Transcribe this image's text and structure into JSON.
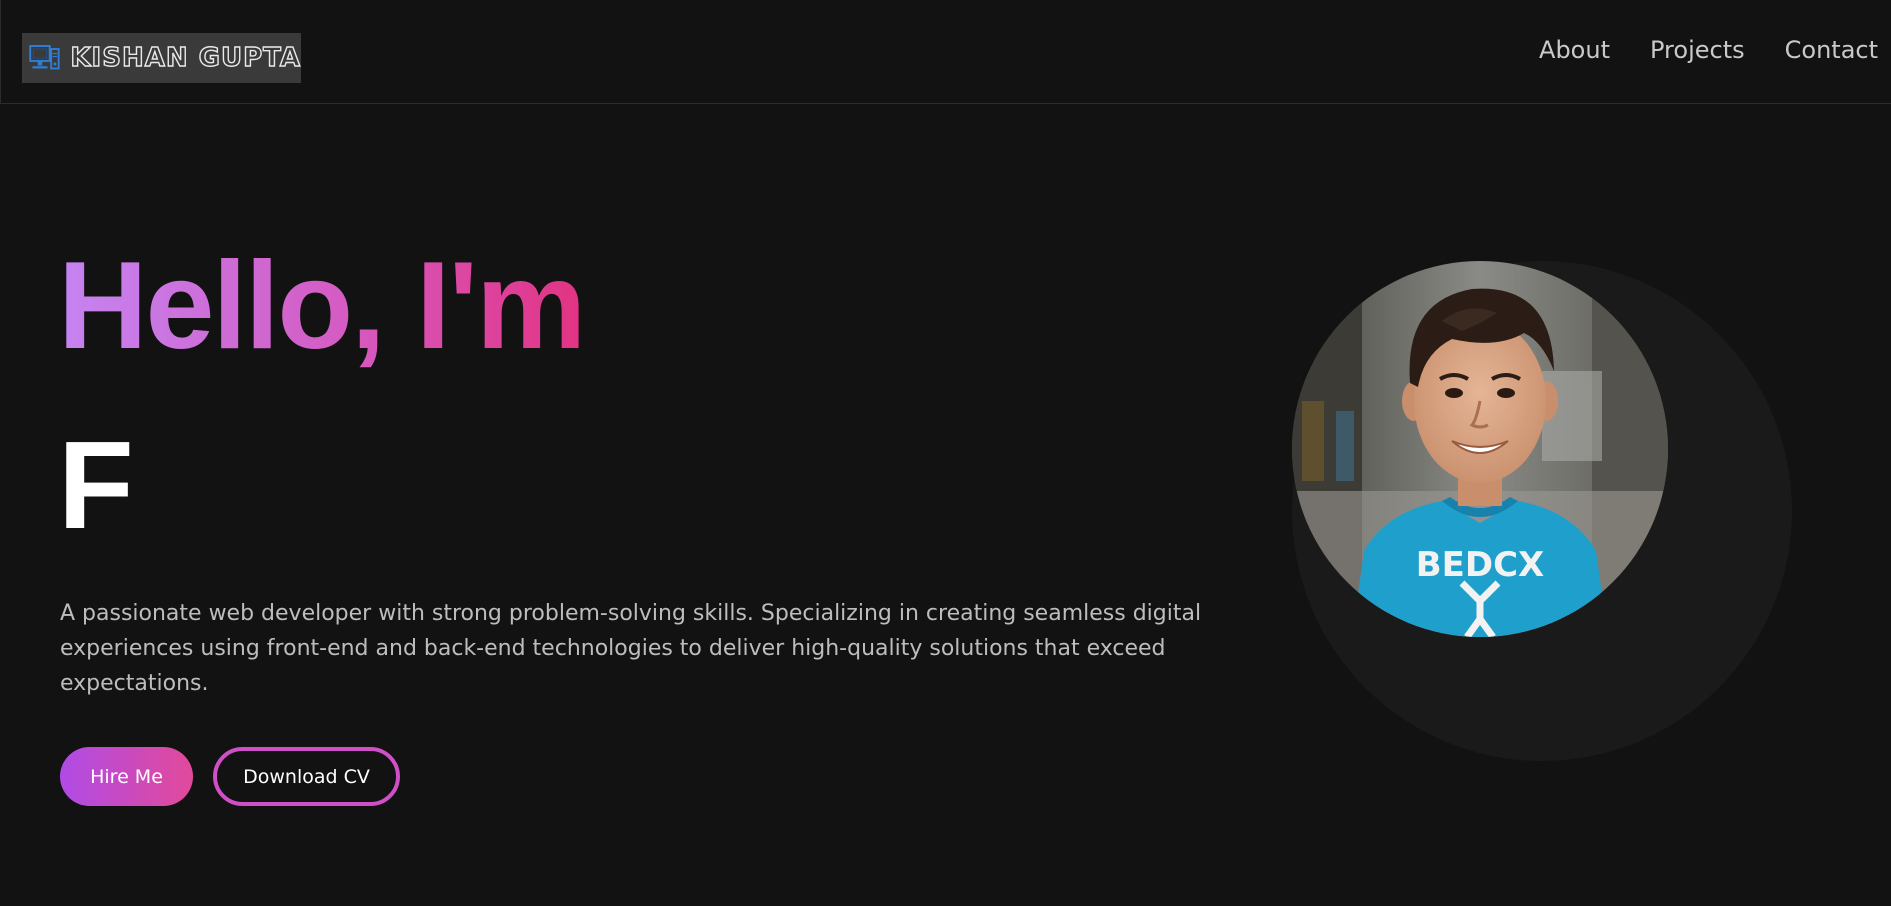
{
  "header": {
    "logo_text": "KISHAN GUPTA",
    "nav": [
      {
        "label": "About"
      },
      {
        "label": "Projects"
      },
      {
        "label": "Contact"
      }
    ]
  },
  "hero": {
    "greeting": "Hello, I'm",
    "typed_text": "F",
    "description": "A passionate web developer with strong problem-solving skills. Specializing in creating seamless digital experiences using front-end and back-end technologies to deliver high-quality solutions that exceed expectations.",
    "buttons": {
      "hire": "Hire Me",
      "download": "Download CV"
    },
    "shirt_text": "BEDCX"
  },
  "colors": {
    "background": "#121212",
    "gradient_start": "#c584f2",
    "gradient_end": "#e23383",
    "button_start": "#b04be6",
    "button_end": "#e24a9a",
    "nav_text": "#c9c9c9",
    "body_text": "#bdbdbd"
  },
  "icons": {
    "logo": "computer-icon"
  }
}
